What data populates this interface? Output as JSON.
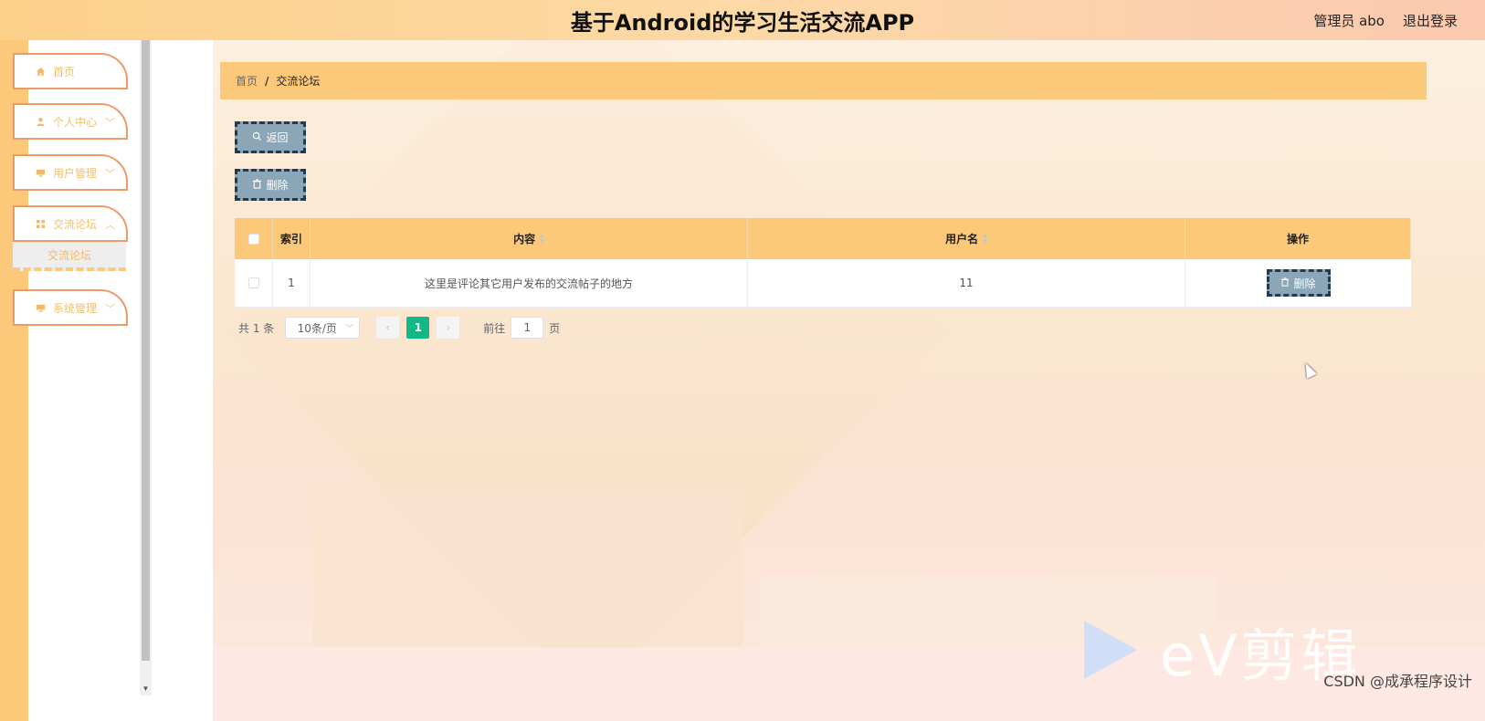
{
  "header": {
    "title": "基于Android的学习生活交流APP",
    "user_label": "管理员 abo",
    "logout_label": "退出登录"
  },
  "sidebar": {
    "items": [
      {
        "label": "首页",
        "icon": "home-icon",
        "has_chevron": false
      },
      {
        "label": "个人中心",
        "icon": "user-icon",
        "has_chevron": true
      },
      {
        "label": "用户管理",
        "icon": "monitor-icon",
        "has_chevron": true
      },
      {
        "label": "交流论坛",
        "icon": "grid-icon",
        "has_chevron": true
      },
      {
        "label": "系统管理",
        "icon": "monitor-icon",
        "has_chevron": true
      }
    ],
    "active_submenu": "交流论坛"
  },
  "breadcrumb": {
    "home": "首页",
    "separator": "/",
    "current": "交流论坛"
  },
  "toolbar": {
    "back_label": "返回",
    "delete_label": "删除"
  },
  "table": {
    "columns": {
      "index": "索引",
      "content": "内容",
      "username": "用户名",
      "actions": "操作"
    },
    "rows": [
      {
        "index": "1",
        "content": "这里是评论其它用户发布的交流帖子的地方",
        "username": "11",
        "action_label": "删除"
      }
    ]
  },
  "pagination": {
    "total": "共 1 条",
    "page_size": "10条/页",
    "current_page": "1",
    "goto_label": "前往",
    "goto_value": "1",
    "page_suffix": "页"
  },
  "watermark": {
    "brand": "eV剪辑",
    "credit": "CSDN @成承程序设计"
  },
  "colors": {
    "accent": "#fcc97a",
    "menu_border": "#ee9a66",
    "button_bg": "#8ba6b6",
    "button_border": "#1f3a52",
    "page_active": "#12b886"
  }
}
